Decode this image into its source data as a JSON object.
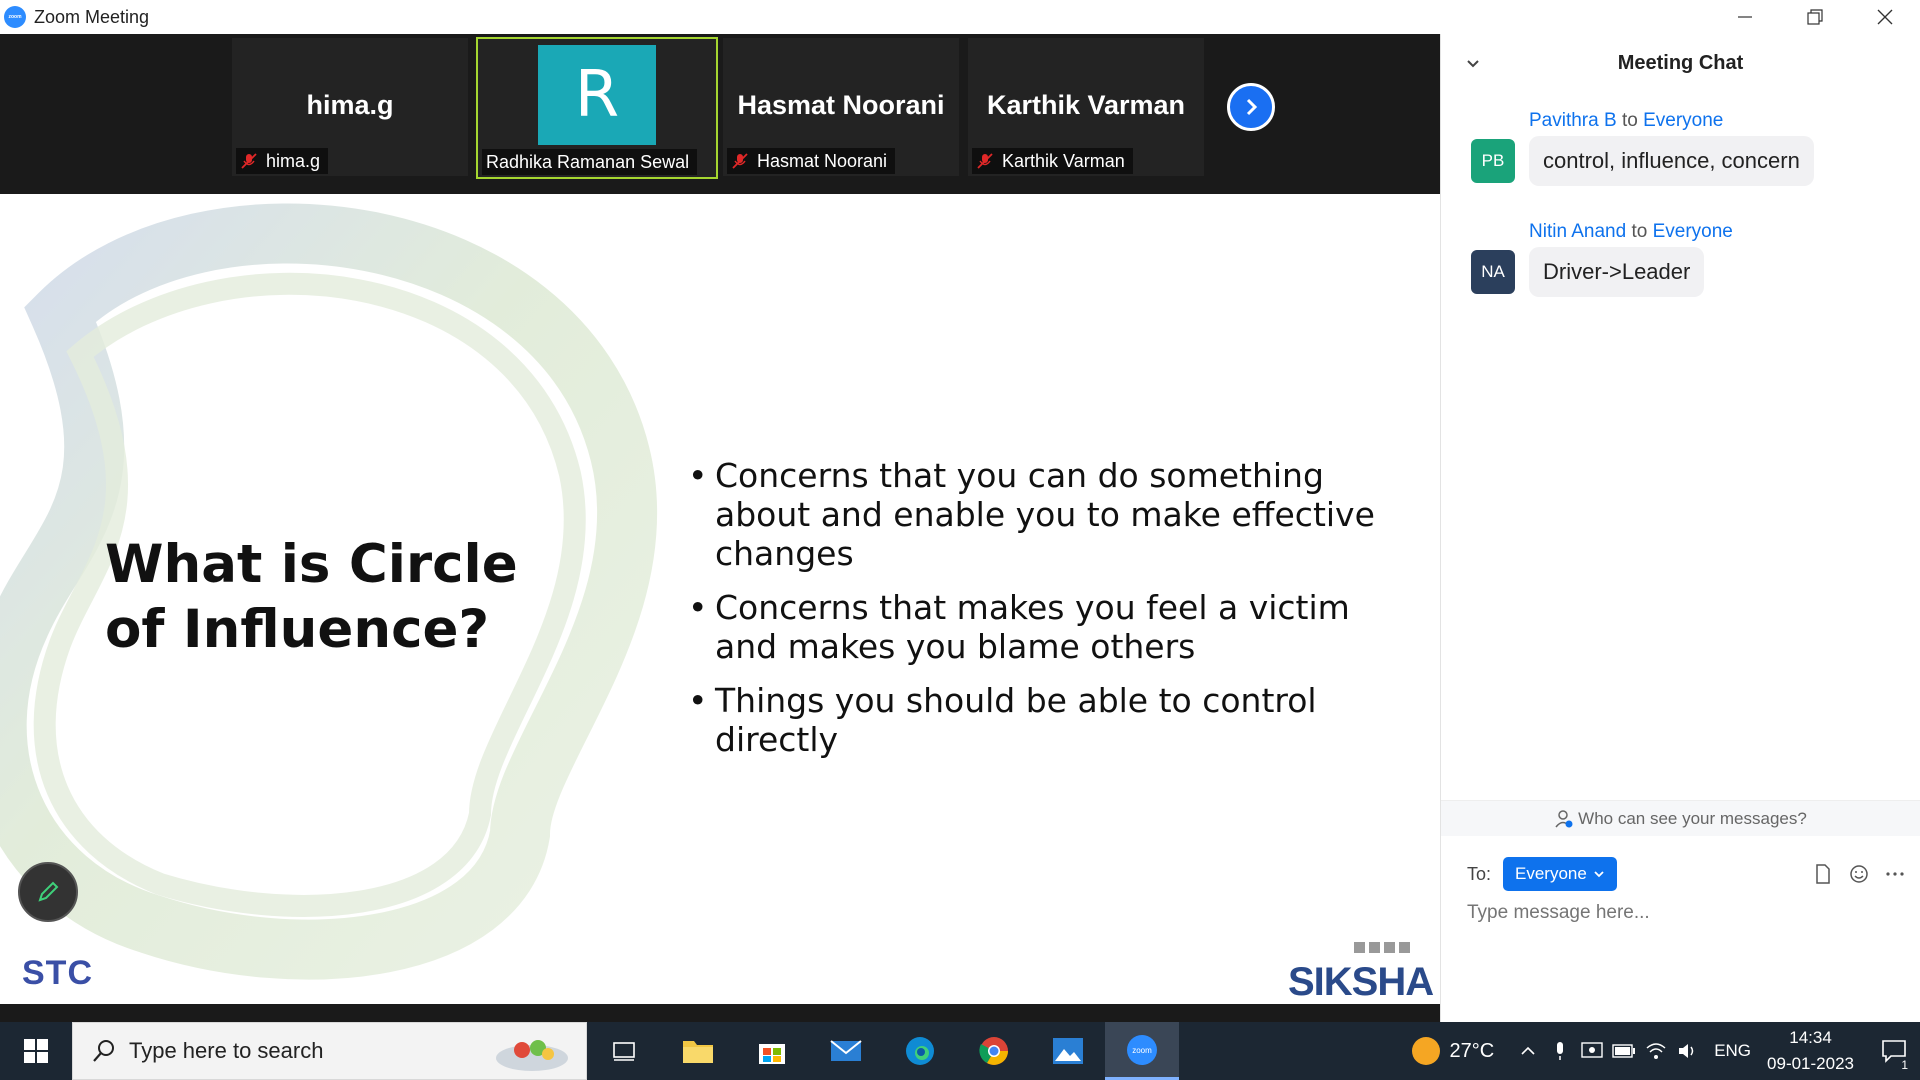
{
  "window": {
    "title": "Zoom Meeting",
    "app_icon_text": "zoom"
  },
  "participants": [
    {
      "display": "hima.g",
      "name_tag": "hima.g",
      "muted": true,
      "active": false
    },
    {
      "display": "R",
      "name_tag": "Radhika Ramanan Sewal",
      "muted": false,
      "active": true,
      "avatar_color": "#1aa8b6"
    },
    {
      "display": "Hasmat Noorani",
      "name_tag": "Hasmat Noorani",
      "muted": true,
      "active": false
    },
    {
      "display": "Karthik Varman",
      "name_tag": "Karthik Varman",
      "muted": true,
      "active": false
    }
  ],
  "slide": {
    "title": "What is Circle of Influence?",
    "bullets": [
      "Concerns that you can do something about and enable you to make effective changes",
      "Concerns that makes you feel a victim and makes you blame others",
      "Things you should be able to control directly"
    ],
    "logo_left": "STC",
    "logo_right": "SIKSHA"
  },
  "chat": {
    "header": "Meeting Chat",
    "messages": [
      {
        "initials": "PB",
        "sender": "Pavithra B",
        "to_word": "to",
        "recipient": "Everyone",
        "text": "control, influence, concern",
        "avatar_color": "#1aa37a"
      },
      {
        "initials": "NA",
        "sender": "Nitin Anand",
        "to_word": "to",
        "recipient": "Everyone",
        "text": "Driver->Leader",
        "avatar_color": "#2b3f5c"
      }
    ],
    "visibility_text": "Who can see your messages?",
    "to_label": "To:",
    "recipient_select": "Everyone",
    "input_placeholder": "Type message here..."
  },
  "taskbar": {
    "search_placeholder": "Type here to search",
    "weather": "27°C",
    "language": "ENG",
    "time": "14:34",
    "date": "09-01-2023",
    "notification_count": "1"
  },
  "colors": {
    "accent": "#0e72ed",
    "zoom_blue": "#2d8cff",
    "active_border": "#a5d630"
  }
}
